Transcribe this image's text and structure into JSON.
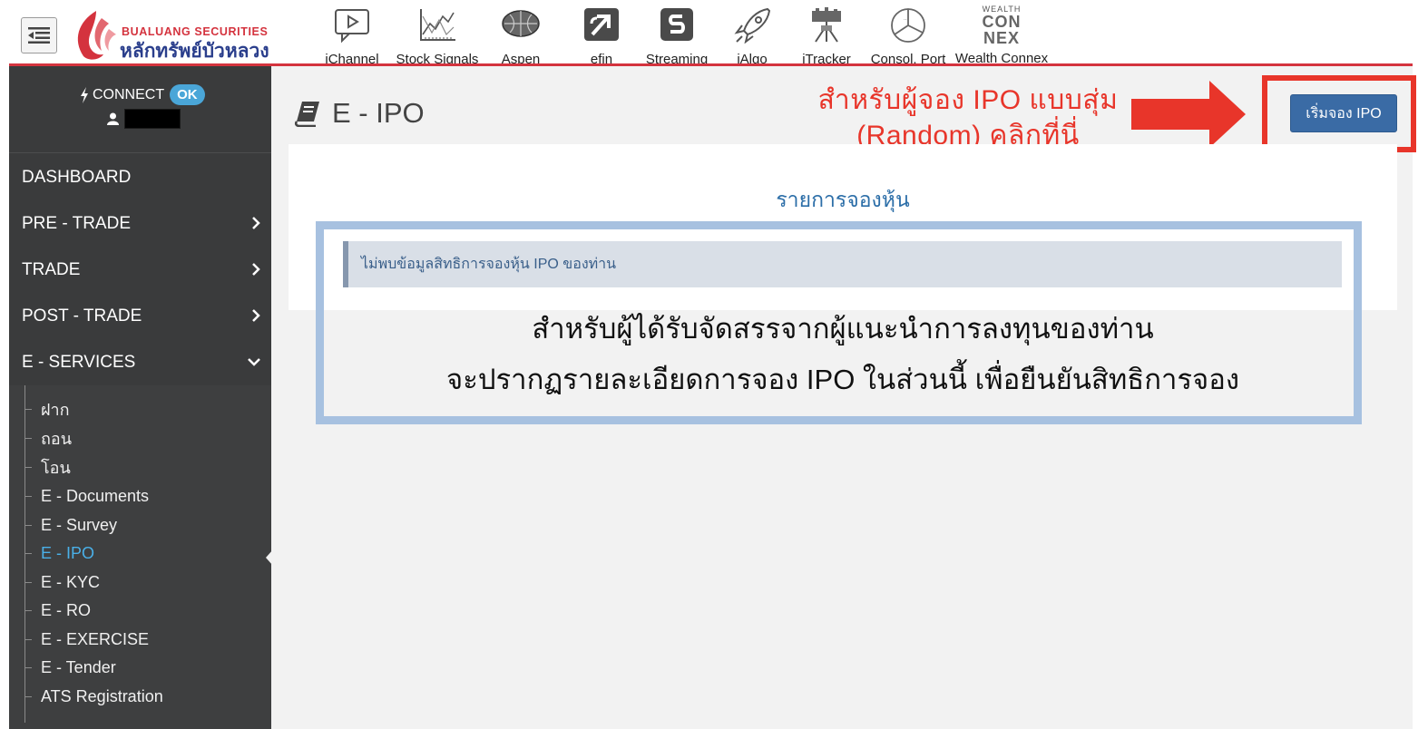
{
  "header": {
    "brand_en": "BUALUANG SECURITIES",
    "brand_th": "หลักทรัพย์บัวหลวง",
    "toolbar": [
      {
        "label": "iChannel",
        "icon": "ichannel-icon"
      },
      {
        "label": "Stock Signals",
        "icon": "stock-signals-icon"
      },
      {
        "label": "Aspen",
        "icon": "aspen-globe-icon"
      },
      {
        "label": "efin",
        "icon": "efin-icon"
      },
      {
        "label": "Streaming",
        "icon": "streaming-icon"
      },
      {
        "label": "iAlgo",
        "icon": "ialgo-rocket-icon"
      },
      {
        "label": "iTracker",
        "icon": "itracker-icon"
      },
      {
        "label": "Consol. Port",
        "icon": "consol-port-pie-icon"
      },
      {
        "label": "Wealth Connex",
        "icon": "wealth-connex-icon",
        "logo_text": [
          "WEALTH",
          "CON",
          "NEX"
        ]
      }
    ],
    "accent_color": "#d4333e"
  },
  "sidebar": {
    "connect_label": "CONNECT",
    "connect_status": "OK",
    "nav": [
      {
        "label": "DASHBOARD",
        "has_arrow": false
      },
      {
        "label": "PRE - TRADE",
        "has_arrow": true
      },
      {
        "label": "TRADE",
        "has_arrow": true
      },
      {
        "label": "POST - TRADE",
        "has_arrow": true
      },
      {
        "label": "E - SERVICES",
        "has_arrow": true,
        "expanded": true
      }
    ],
    "sub_items": [
      {
        "label": "ฝาก"
      },
      {
        "label": "ถอน"
      },
      {
        "label": "โอน"
      },
      {
        "label": "E - Documents"
      },
      {
        "label": "E - Survey"
      },
      {
        "label": "E - IPO",
        "active": true
      },
      {
        "label": "E - KYC"
      },
      {
        "label": "E - RO"
      },
      {
        "label": "E - EXERCISE"
      },
      {
        "label": "E - Tender"
      },
      {
        "label": "ATS Registration"
      }
    ]
  },
  "main": {
    "page_title": "E - IPO",
    "annotation_line1": "สำหรับผู้จอง IPO แบบสุ่ม",
    "annotation_line2": "(Random) คลิกที่นี่",
    "start_button": "เริ่มจอง IPO",
    "panel_title": "รายการจองหุ้น",
    "alert_text": "ไม่พบข้อมูลสิทธิการจองหุ้น IPO ของท่าน",
    "note_line1": "สำหรับผู้ได้รับจัดสรรจากผู้แนะนำการลงทุนของท่าน",
    "note_line2": "จะปรากฏรายละเอียดการจอง IPO ในส่วนนี้ เพื่อยืนยันสิทธิการจอง",
    "annotation_color": "#e8352a",
    "button_color": "#3a6ba5"
  }
}
